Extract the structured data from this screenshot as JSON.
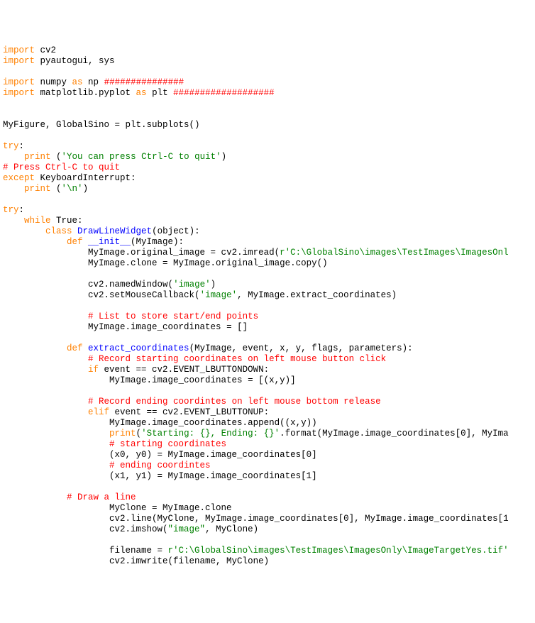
{
  "l1_import": "import",
  "l1_cv2": " cv2",
  "l2_import": "import",
  "l2_rest": " pyautogui, sys",
  "l4_import": "import",
  "l4_numpy": " numpy ",
  "l4_as": "as",
  "l4_np": " np ",
  "l4_hash": "###############",
  "l5_import": "import",
  "l5_mpl": " matplotlib.pyplot ",
  "l5_as": "as",
  "l5_plt": " plt ",
  "l5_hash": "###################",
  "l8_assign": "MyFigure, GlobalSino = plt.subplots()",
  "l10_try": "try",
  "l10_colon": ":",
  "l11_print": "print",
  "l11_open": " (",
  "l11_str": "'You can press Ctrl-C to quit'",
  "l11_close": ")",
  "l12_cm": "# Press Ctrl-C to quit",
  "l13_except": "except",
  "l13_rest": " KeyboardInterrupt:",
  "l14_print": "print",
  "l14_open": " (",
  "l14_str": "'\\n'",
  "l14_close": ")",
  "l16_try": "try",
  "l16_colon": ":",
  "l17_while": "while",
  "l17_true": " True:",
  "l18_class": "class",
  "l18_name": " DrawLineWidget",
  "l18_args": "(object):",
  "l19_def": "def",
  "l19_name": " __init__",
  "l19_args": "(MyImage):",
  "l20_a": "MyImage.original_image = cv2.imread(",
  "l20_str": "r'C:\\GlobalSino\\images\\TestImages\\ImagesOnl",
  "l21": "MyImage.clone = MyImage.original_image.copy()",
  "l23_a": "cv2.namedWindow(",
  "l23_str": "'image'",
  "l23_b": ")",
  "l24_a": "cv2.setMouseCallback(",
  "l24_str": "'image'",
  "l24_b": ", MyImage.extract_coordinates)",
  "l26_cm": "# List to store start/end points",
  "l27": "MyImage.image_coordinates = []",
  "l29_def": "def",
  "l29_name": " extract_coordinates",
  "l29_args": "(MyImage, event, x, y, flags, parameters):",
  "l30_cm": "# Record starting coordinates on left mouse button click",
  "l31_if": "if",
  "l31_rest": " event == cv2.EVENT_LBUTTONDOWN:",
  "l32": "MyImage.image_coordinates = [(x,y)]",
  "l34_cm": "# Record ending coordintes on left mouse bottom release",
  "l35_elif": "elif",
  "l35_rest": " event == cv2.EVENT_LBUTTONUP:",
  "l36": "MyImage.image_coordinates.append((x,y))",
  "l37_print": "print",
  "l37_a": "(",
  "l37_str": "'Starting: {}, Ending: {}'",
  "l37_b": ".format(MyImage.image_coordinates[0], MyIma",
  "l38_cm": "# starting coordinates",
  "l39": "(x0, y0) = MyImage.image_coordinates[0]",
  "l40_cm": "# ending coordintes",
  "l41": "(x1, y1) = MyImage.image_coordinates[1]",
  "l43_cm": "# Draw a line",
  "l44": "MyClone = MyImage.clone",
  "l45_a": "cv2.line(MyClone, MyImage.image_coordinates[0], MyImage.image_coordinates[1",
  "l46_a": "cv2.imshow(",
  "l46_str": "\"image\"",
  "l46_b": ", MyClone)",
  "l48_a": "filename = ",
  "l48_str": "r'C:\\GlobalSino\\images\\TestImages\\ImagesOnly\\ImageTargetYes.tif'",
  "l49": "cv2.imwrite(filename, MyClone)"
}
